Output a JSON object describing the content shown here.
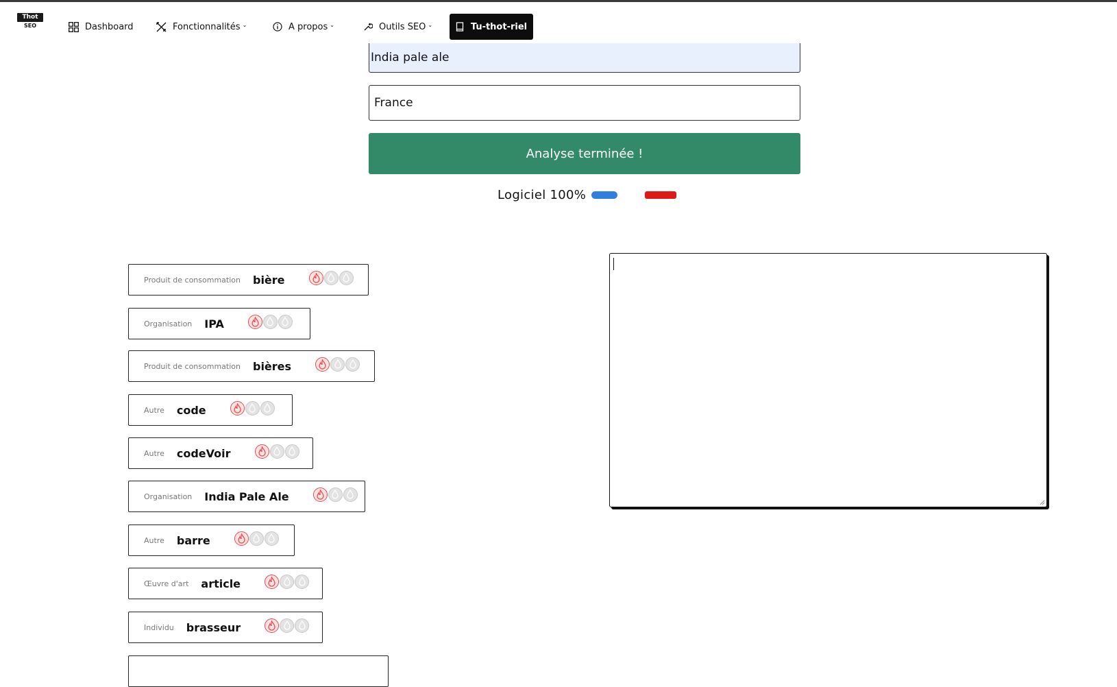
{
  "nav": {
    "logo_top": "Thot",
    "logo_bottom": "SEO",
    "dashboard": "Dashboard",
    "features": "Fonctionnalités",
    "about": "A propos",
    "seo_tools": "Outils SEO",
    "tutorial": "Tu-thot-riel"
  },
  "form": {
    "keyword_value": "India pale ale",
    "country_value": "France",
    "analyse_label": "Analyse terminée !",
    "progress_label": "Logiciel 100%",
    "progress_fraction": 1.0
  },
  "entities": [
    {
      "type": "Produit de consommation",
      "name": "bière",
      "level": 1
    },
    {
      "type": "Organisation",
      "name": "IPA",
      "level": 1
    },
    {
      "type": "Produit de consommation",
      "name": "bières",
      "level": 1
    },
    {
      "type": "Autre",
      "name": "code",
      "level": 1
    },
    {
      "type": "Autre",
      "name": "codeVoir",
      "level": 1
    },
    {
      "type": "Organisation",
      "name": "India Pale Ale",
      "level": 1
    },
    {
      "type": "Autre",
      "name": "barre",
      "level": 1
    },
    {
      "type": "Œuvre d'art",
      "name": "article",
      "level": 1
    },
    {
      "type": "Individu",
      "name": "brasseur",
      "level": 1
    }
  ],
  "editor": {
    "value": ""
  },
  "colors": {
    "accent_green": "#328a68",
    "bar_blue": "#2f7fe0",
    "bar_red": "#df1818",
    "flame_red": "#e54d4d"
  }
}
